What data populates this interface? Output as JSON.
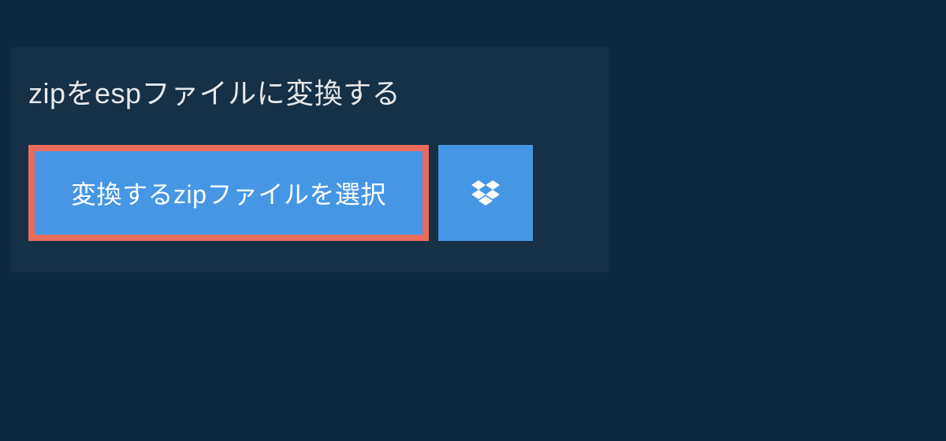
{
  "heading": "zipをespファイルに変換する",
  "buttons": {
    "select_label": "変換するzipファイルを選択"
  }
}
